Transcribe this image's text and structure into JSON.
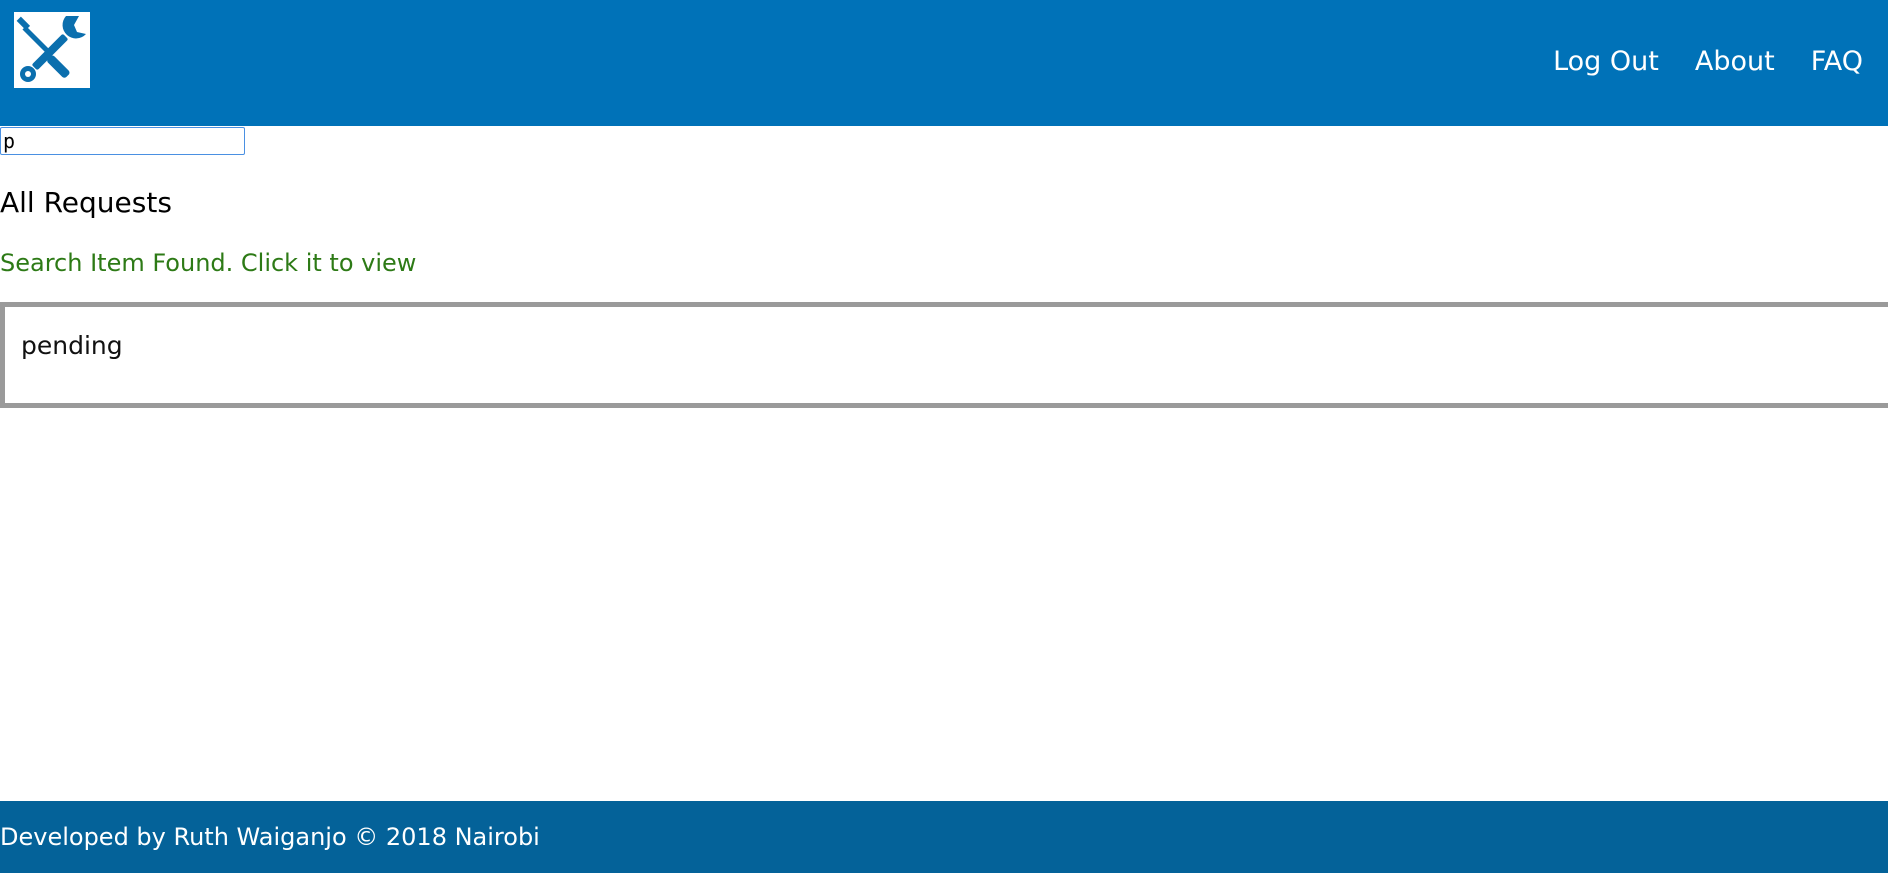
{
  "header": {
    "logo_icon": "wrench-screwdriver-icon",
    "nav": [
      {
        "label": "Log Out"
      },
      {
        "label": "About"
      },
      {
        "label": "FAQ"
      }
    ]
  },
  "search": {
    "value": "p"
  },
  "main": {
    "title": "All Requests",
    "status_message": "Search Item Found. Click it to view",
    "results": [
      {
        "label": "pending"
      }
    ]
  },
  "footer": {
    "text": "Developed by Ruth Waiganjo © 2018 Nairobi"
  },
  "colors": {
    "header_bg": "#0072b8",
    "footer_bg": "#046299",
    "success_text": "#2d7a16",
    "result_border": "#9a9a9a"
  }
}
